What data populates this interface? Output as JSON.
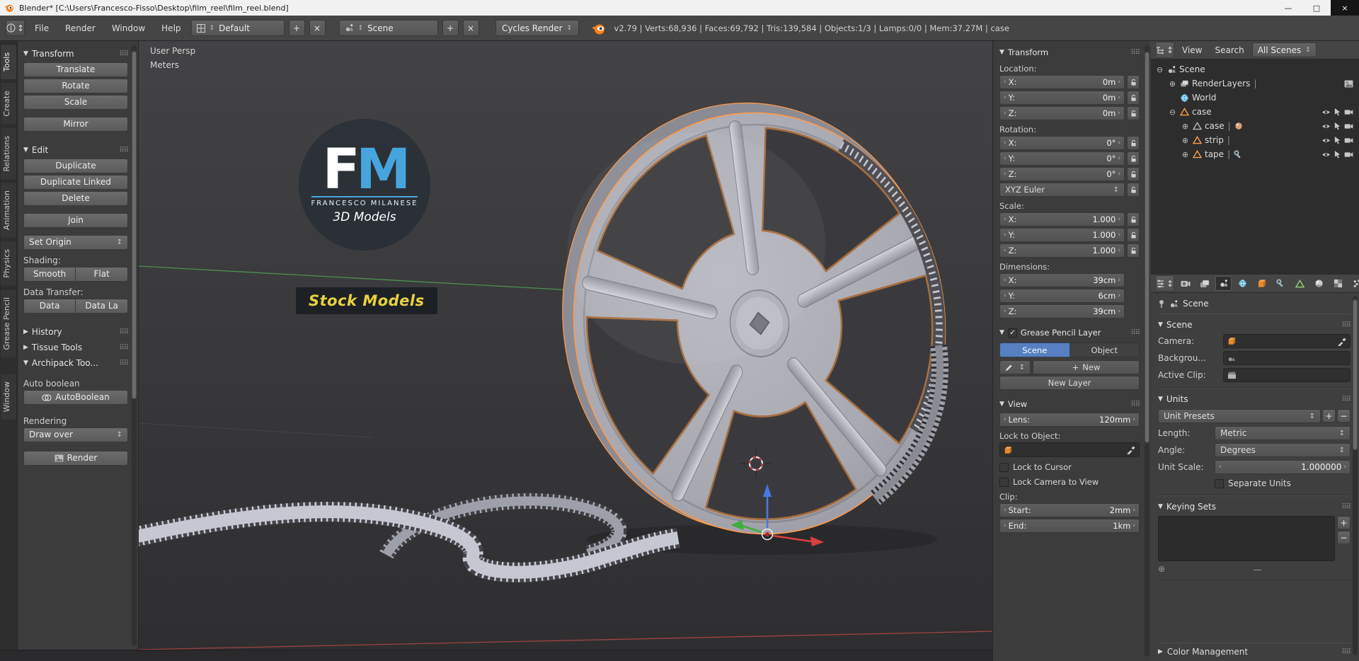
{
  "icons": {
    "tri_down": "▼",
    "tri_right": "▶",
    "grip": "⠿⠿",
    "left": "‹",
    "right": "›",
    "updown": "↕",
    "plus": "+",
    "close_x": "×",
    "expand": "⊕",
    "collapse": "⊖",
    "check": "✓",
    "minus": "−",
    "dash": "—",
    "pipe": "|",
    "info": "i"
  },
  "titlebar": {
    "title": "Blender* [C:\\Users\\Francesco-Fisso\\Desktop\\film_reel\\film_reel.blend]",
    "minimize": "—",
    "maximize": "□",
    "close": "×"
  },
  "menubar": {
    "menus": [
      "File",
      "Render",
      "Window",
      "Help"
    ],
    "layout": "Default",
    "scene": "Scene",
    "engine": "Cycles Render",
    "stats": "v2.79 | Verts:68,936 | Faces:69,792 | Tris:139,584 | Objects:1/3 | Lamps:0/0 | Mem:37.27M | case"
  },
  "tool_tabs": [
    "Tools",
    "Create",
    "Relations",
    "Animation",
    "Physics",
    "Grease Pencil",
    "Window"
  ],
  "toolshelf": {
    "transform": {
      "title": "Transform",
      "translate": "Translate",
      "rotate": "Rotate",
      "scale": "Scale",
      "mirror": "Mirror"
    },
    "edit": {
      "title": "Edit",
      "duplicate": "Duplicate",
      "duplicate_linked": "Duplicate Linked",
      "delete": "Delete",
      "join": "Join",
      "set_origin": "Set Origin",
      "shading_label": "Shading:",
      "smooth": "Smooth",
      "flat": "Flat",
      "data_transfer_label": "Data Transfer:",
      "data": "Data",
      "data_layout": "Data La"
    },
    "history": "History",
    "tissue": "Tissue Tools",
    "archipack": {
      "title": "Archipack Too...",
      "auto_boolean_label": "Auto boolean",
      "autoboolean": "AutoBoolean",
      "rendering_label": "Rendering",
      "draw_over": "Draw over",
      "render": "Render"
    }
  },
  "viewport": {
    "view_name": "User Persp",
    "unit": "Meters",
    "logo": {
      "f": "F",
      "m": "M",
      "name": "FRANCESCO MILANESE",
      "sub": "3D Models",
      "stock": "Stock Models"
    }
  },
  "npanel": {
    "transform_title": "Transform",
    "location_label": "Location:",
    "loc": [
      {
        "l": "X:",
        "v": "0m"
      },
      {
        "l": "Y:",
        "v": "0m"
      },
      {
        "l": "Z:",
        "v": "0m"
      }
    ],
    "rotation_label": "Rotation:",
    "rot": [
      {
        "l": "X:",
        "v": "0°"
      },
      {
        "l": "Y:",
        "v": "0°"
      },
      {
        "l": "Z:",
        "v": "0°"
      }
    ],
    "euler": "XYZ Euler",
    "scale_label": "Scale:",
    "scl": [
      {
        "l": "X:",
        "v": "1.000"
      },
      {
        "l": "Y:",
        "v": "1.000"
      },
      {
        "l": "Z:",
        "v": "1.000"
      }
    ],
    "dimensions_label": "Dimensions:",
    "dim": [
      {
        "l": "X:",
        "v": "39cm"
      },
      {
        "l": "Y:",
        "v": "6cm"
      },
      {
        "l": "Z:",
        "v": "39cm"
      }
    ],
    "gp_title": "Grease Pencil Layer",
    "gp_scene": "Scene",
    "gp_object": "Object",
    "gp_new": "New",
    "gp_new_layer": "New Layer",
    "view_title": "View",
    "lens_label": "Lens:",
    "lens_value": "120mm",
    "lock_object_label": "Lock to Object:",
    "lock_cursor": "Lock to Cursor",
    "lock_camera": "Lock Camera to View",
    "clip_label": "Clip:",
    "clip_start_label": "Start:",
    "clip_start": "2mm",
    "clip_end_label": "End:",
    "clip_end": "1km"
  },
  "outliner": {
    "view": "View",
    "search": "Search",
    "all_scenes": "All Scenes",
    "scene": "Scene",
    "renderlayers": "RenderLayers",
    "world": "World",
    "case_obj": "case",
    "case_data": "case",
    "strip": "strip",
    "tape": "tape"
  },
  "properties": {
    "breadcrumb": "Scene",
    "scene_title": "Scene",
    "camera_label": "Camera:",
    "background_label": "Backgrou...",
    "active_clip_label": "Active Clip:",
    "units_title": "Units",
    "unit_presets": "Unit Presets",
    "length_label": "Length:",
    "length_value": "Metric",
    "angle_label": "Angle:",
    "angle_value": "Degrees",
    "unit_scale_label": "Unit Scale:",
    "unit_scale_value": "1.000000",
    "separate_units": "Separate Units",
    "keying_title": "Keying Sets",
    "color_title": "Color Management"
  }
}
